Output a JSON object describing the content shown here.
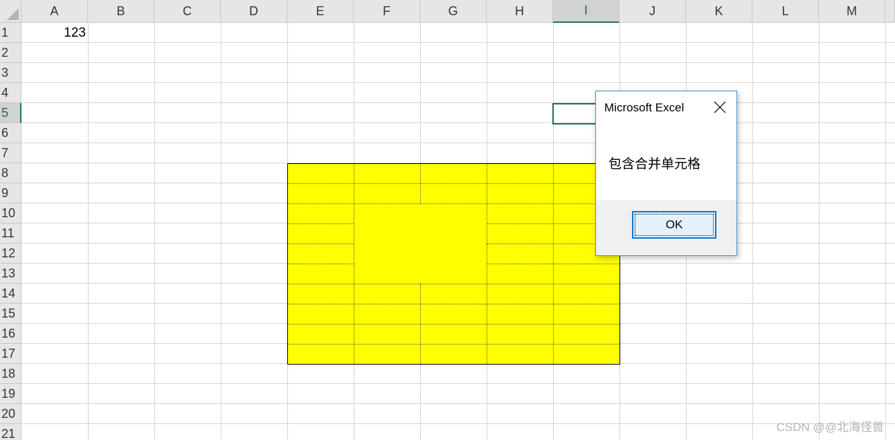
{
  "sheet": {
    "columns": [
      "A",
      "B",
      "C",
      "D",
      "E",
      "F",
      "G",
      "H",
      "I",
      "J",
      "K",
      "L",
      "M"
    ],
    "rows": [
      "1",
      "2",
      "3",
      "4",
      "5",
      "6",
      "7",
      "8",
      "9",
      "10",
      "11",
      "12",
      "13",
      "14",
      "15",
      "16",
      "17",
      "18",
      "19",
      "20",
      "21"
    ],
    "selected_column": "I",
    "selected_row": "5",
    "cell_a1": "123",
    "highlight_color": "#ffff00"
  },
  "dialog": {
    "title": "Microsoft Excel",
    "message": "包含合并单元格",
    "ok_label": "OK",
    "close_icon": "close-icon"
  },
  "watermark": "CSDN @@北海怪兽"
}
